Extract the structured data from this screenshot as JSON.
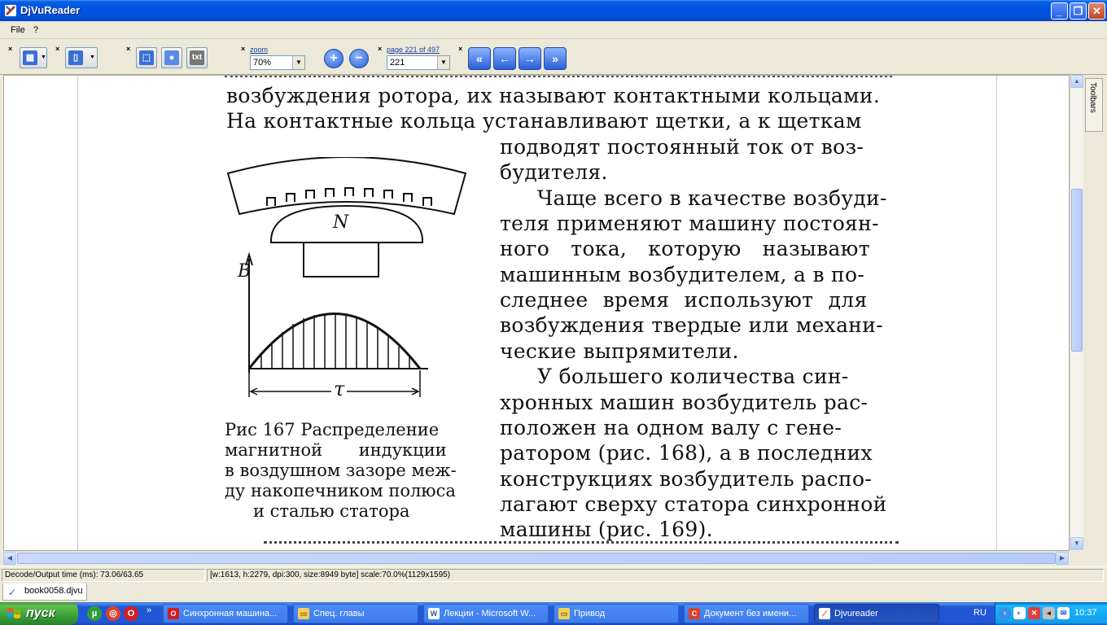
{
  "window": {
    "title": "DjVuReader"
  },
  "menu": {
    "file": "File",
    "help": "?"
  },
  "toolbar": {
    "close_marks": "×",
    "text_button": "txt",
    "zoom_label": "zoom",
    "zoom_value": "70%",
    "page_label": "page 221 of 497",
    "page_value": "221"
  },
  "document": {
    "lines_top": [
      "возбуждения ротора, их называют контактными кольцами.",
      "На контактные кольца устанавливают щетки, а к щеткам"
    ],
    "lines_right": [
      "подводят постоянный ток от воз-",
      "будителя.",
      "Чаще всего в качестве возбуди-",
      "теля применяют машину постоян-",
      "ного тока, которую называют",
      "машинным возбудителем, а в по-",
      "следнее время используют для",
      "возбуждения твердые или механи-",
      "ческие выпрямители.",
      "У большего количества син-",
      "хронных машин возбудитель рас-",
      "положен на одном валу с гене-",
      "ратором (рис. 168), а в последних",
      "конструкциях возбудитель распо-",
      "лагают сверху статора синхронной",
      "машины (рис. 169)."
    ],
    "figure_pole_label": "N",
    "figure_axis_label": "B",
    "figure_tau_label": "τ",
    "caption": [
      "Рис 167 Распределение",
      "магнитной индукции",
      "в воздушном зазоре меж-",
      "ду накопечником полюса",
      "и сталью статора"
    ]
  },
  "side_panel": {
    "label": "Toolbars"
  },
  "status": {
    "decode": "Decode/Output time (ms): 73.06/63.65",
    "info": "[w:1613, h:2279, dpi:300, size:8949 byte] scale:70.0%(1129x1595)"
  },
  "doc_tab": {
    "label": "book0058.djvu"
  },
  "taskbar": {
    "start": "пуск",
    "tasks": [
      "Синхронная машина...",
      "Спец. главы",
      "Лекции - Microsoft W...",
      "Привод",
      "Документ без имени...",
      "Djvureader"
    ],
    "lang": "RU",
    "clock": "10:37"
  },
  "colors": {
    "titlebar": "#0054e3",
    "taskbar": "#2157d7",
    "start_green": "#38a038",
    "accent": "#1a3fa8"
  }
}
